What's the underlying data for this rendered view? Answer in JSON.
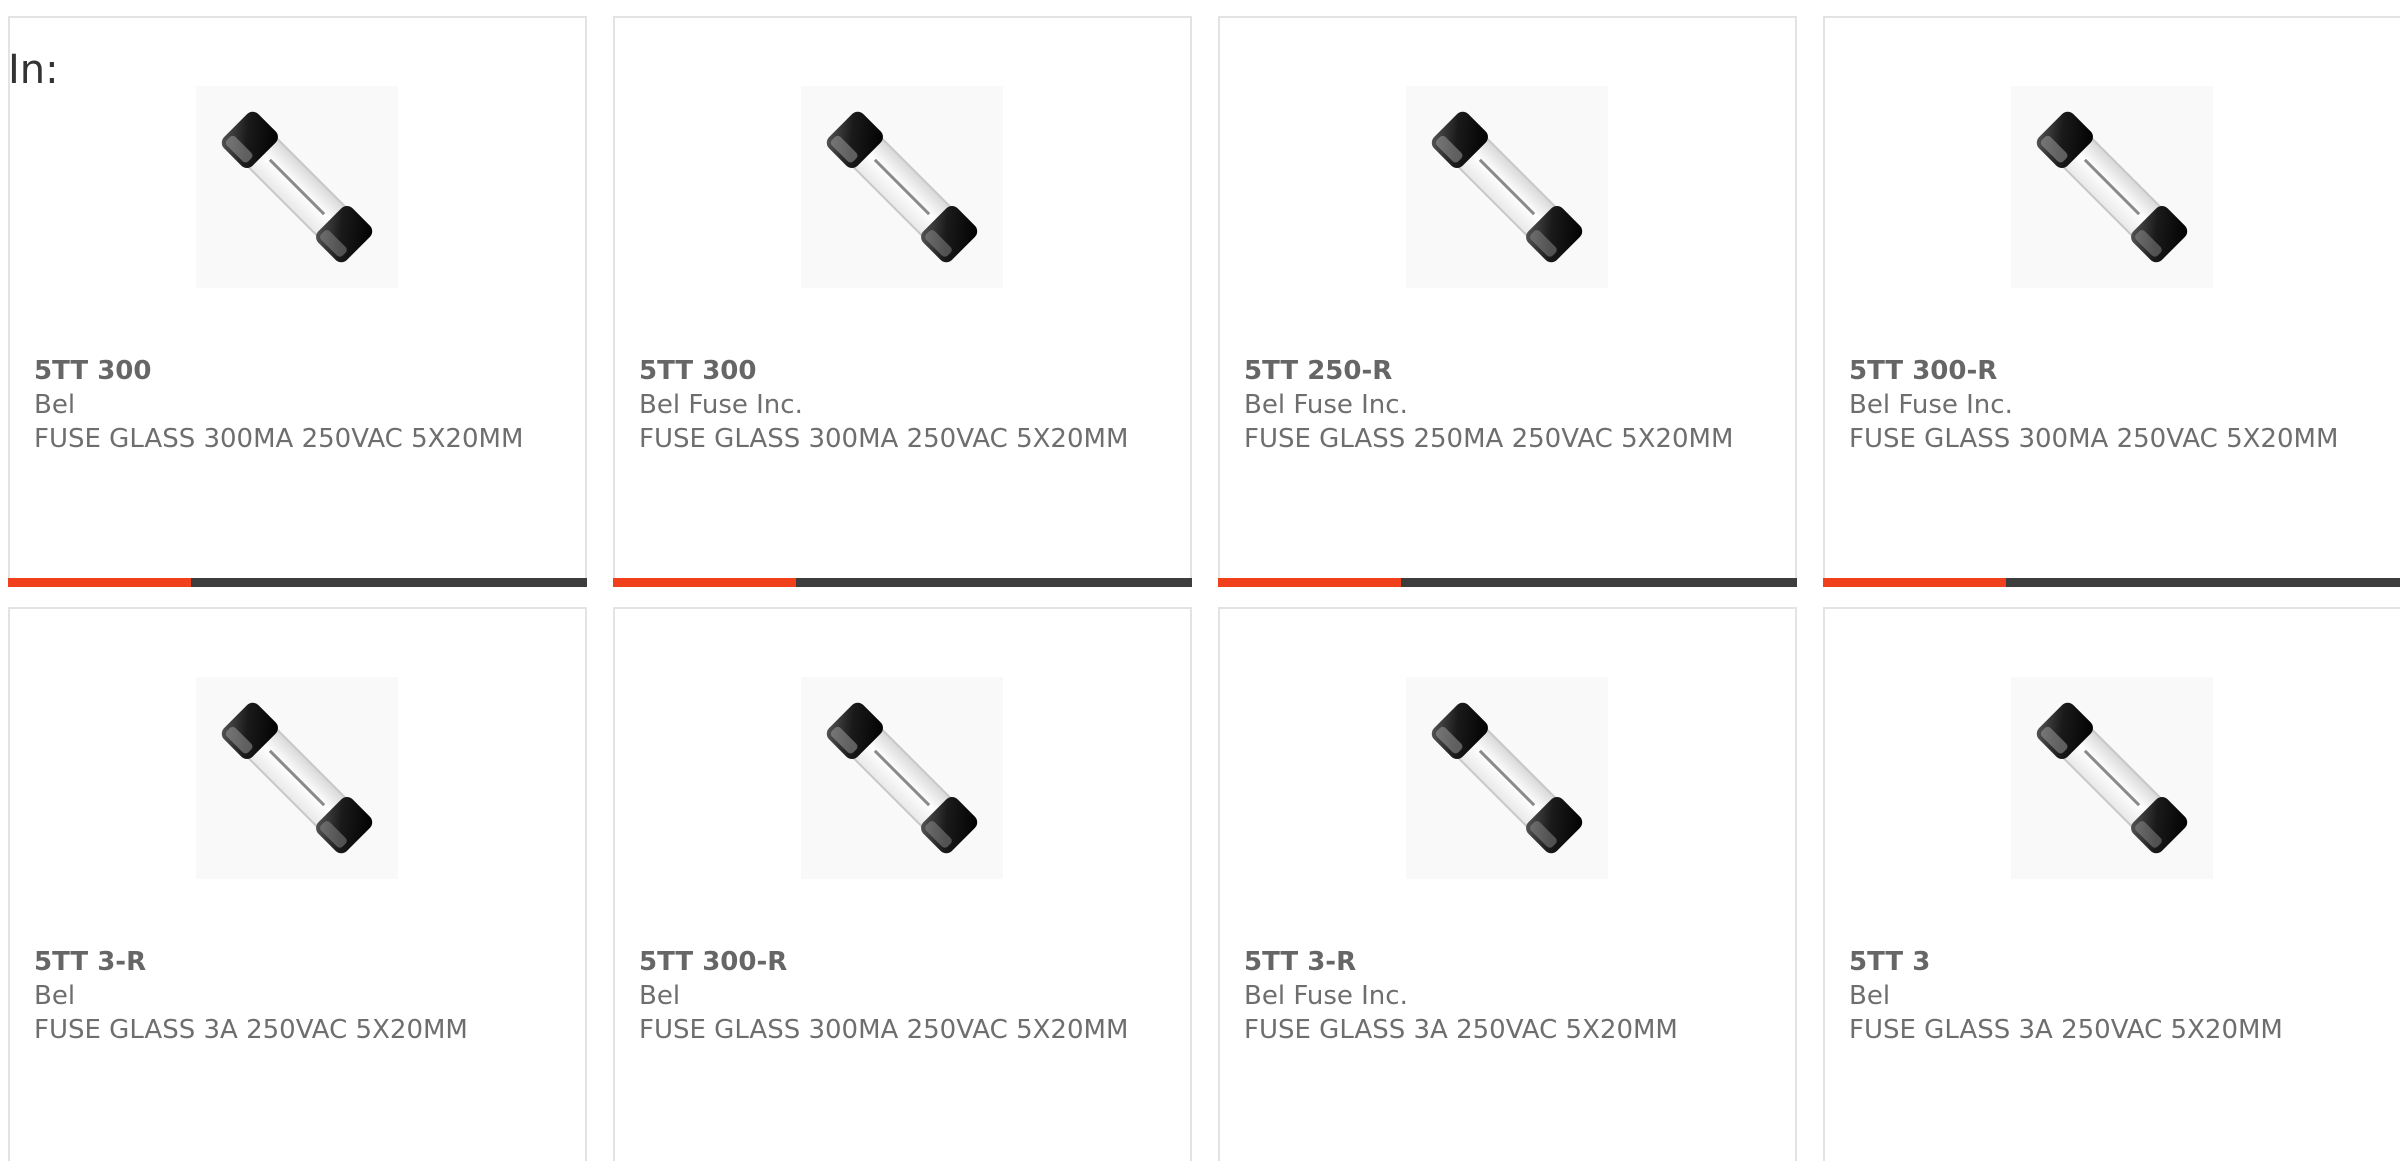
{
  "search": {
    "in_label": "In:"
  },
  "colors": {
    "accent": "#f0401c",
    "bar": "#3d3d3d",
    "text": "#6e6e6e",
    "border": "#e3e3e3"
  },
  "products": [
    {
      "part": "5TT 300",
      "manufacturer": "Bel",
      "description": "FUSE GLASS 300MA 250VAC 5X20MM",
      "image_icon": "glass-fuse-icon"
    },
    {
      "part": "5TT 300",
      "manufacturer": "Bel Fuse Inc.",
      "description": "FUSE GLASS 300MA 250VAC 5X20MM",
      "image_icon": "glass-fuse-icon"
    },
    {
      "part": "5TT 250-R",
      "manufacturer": "Bel Fuse Inc.",
      "description": "FUSE GLASS 250MA 250VAC 5X20MM",
      "image_icon": "glass-fuse-icon"
    },
    {
      "part": "5TT 300-R",
      "manufacturer": "Bel Fuse Inc.",
      "description": "FUSE GLASS 300MA 250VAC 5X20MM",
      "image_icon": "glass-fuse-icon"
    },
    {
      "part": "5TT 3-R",
      "manufacturer": "Bel",
      "description": "FUSE GLASS 3A 250VAC 5X20MM",
      "image_icon": "glass-fuse-icon"
    },
    {
      "part": "5TT 300-R",
      "manufacturer": "Bel",
      "description": "FUSE GLASS 300MA 250VAC 5X20MM",
      "image_icon": "glass-fuse-icon"
    },
    {
      "part": "5TT 3-R",
      "manufacturer": "Bel Fuse Inc.",
      "description": "FUSE GLASS 3A 250VAC 5X20MM",
      "image_icon": "glass-fuse-icon"
    },
    {
      "part": "5TT 3",
      "manufacturer": "Bel",
      "description": "FUSE GLASS 3A 250VAC 5X20MM",
      "image_icon": "glass-fuse-icon"
    }
  ]
}
